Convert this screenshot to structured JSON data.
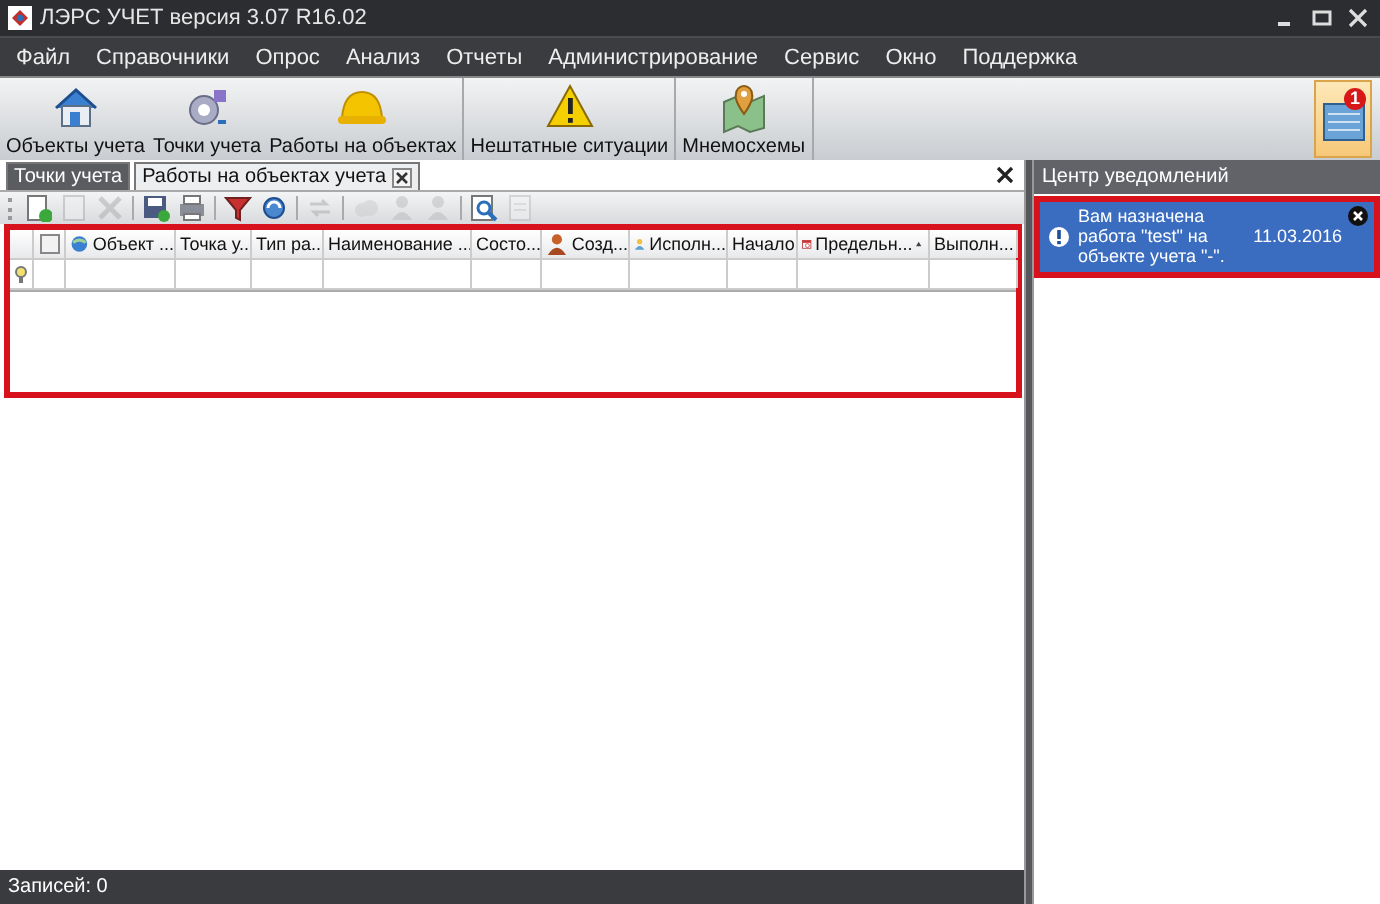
{
  "window": {
    "title": "ЛЭРС УЧЕТ версия 3.07 R16.02"
  },
  "menu": [
    "Файл",
    "Справочники",
    "Опрос",
    "Анализ",
    "Отчеты",
    "Администрирование",
    "Сервис",
    "Окно",
    "Поддержка"
  ],
  "ribbon": {
    "groups": [
      {
        "buttons": [
          {
            "label": "Объекты учета"
          },
          {
            "label": "Точки учета"
          },
          {
            "label": "Работы на объектах"
          }
        ]
      },
      {
        "buttons": [
          {
            "label": "Нештатные ситуации"
          }
        ]
      },
      {
        "buttons": [
          {
            "label": "Мнемосхемы"
          }
        ]
      }
    ],
    "notifications_button": {
      "badge": "1",
      "selected": true
    }
  },
  "tabs": [
    {
      "label": "Точки учета",
      "selected": false,
      "closable": false
    },
    {
      "label": "Работы на объектах учета",
      "selected": true,
      "closable": true
    }
  ],
  "toolbar": [
    {
      "kind": "add",
      "disabled": false
    },
    {
      "kind": "edit",
      "disabled": true
    },
    {
      "kind": "delete",
      "disabled": true
    },
    {
      "kind": "sep"
    },
    {
      "kind": "export",
      "disabled": false
    },
    {
      "kind": "print",
      "disabled": false
    },
    {
      "kind": "sep"
    },
    {
      "kind": "filter",
      "disabled": false
    },
    {
      "kind": "refresh",
      "disabled": false
    },
    {
      "kind": "sep"
    },
    {
      "kind": "sync",
      "disabled": true
    },
    {
      "kind": "sep"
    },
    {
      "kind": "cloud",
      "disabled": true
    },
    {
      "kind": "person",
      "disabled": true
    },
    {
      "kind": "person",
      "disabled": true
    },
    {
      "kind": "sep"
    },
    {
      "kind": "search",
      "disabled": false
    },
    {
      "kind": "page",
      "disabled": true
    }
  ],
  "grid": {
    "highlighted": true,
    "columns": [
      {
        "label": "Объект ...",
        "sorted": false
      },
      {
        "label": "Точка у...",
        "sorted": false
      },
      {
        "label": "Тип ра...",
        "sorted": false
      },
      {
        "label": "Наименование ...",
        "sorted": false
      },
      {
        "label": "Состо...",
        "sorted": false
      },
      {
        "label": "Созд...",
        "sorted": false
      },
      {
        "label": "Исполн...",
        "sorted": false
      },
      {
        "label": "Начало",
        "sorted": false
      },
      {
        "label": "Предельн...",
        "sorted": true
      },
      {
        "label": "Выполн...",
        "sorted": false
      }
    ],
    "select_all": {
      "checked": false
    }
  },
  "status_bar": "Записей: 0",
  "notification_center": {
    "title": "Центр уведомлений",
    "items": [
      {
        "text": "Вам назначена работа \"test\" на объекте учета \"-\".",
        "date": "11.03.2016",
        "highlighted": true,
        "selected": true
      }
    ]
  }
}
